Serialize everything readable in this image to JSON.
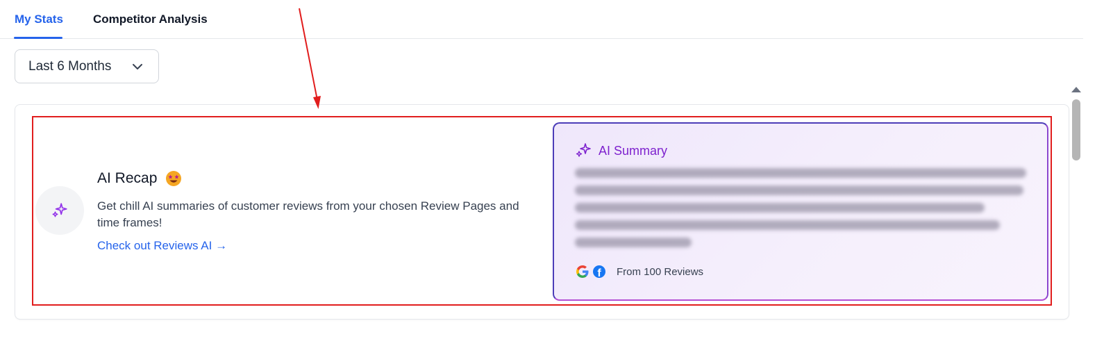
{
  "tabs": [
    {
      "label": "My Stats",
      "active": true
    },
    {
      "label": "Competitor Analysis",
      "active": false
    }
  ],
  "range_select": {
    "value": "Last 6 Months",
    "icon": "chevron-down-icon"
  },
  "recap": {
    "title": "AI Recap",
    "emoji_icon": "star-struck-emoji-icon",
    "description": "Get chill AI summaries of customer reviews from your chosen Review Pages and time frames!",
    "link_label": "Check out Reviews AI →",
    "icon": "sparkles-icon"
  },
  "summary": {
    "title": "AI Summary",
    "icon": "sparkles-icon",
    "source_label": "From 100 Reviews",
    "source_icons": [
      "google-icon",
      "facebook-icon"
    ]
  },
  "colors": {
    "accent": "#2563eb",
    "summary_accent": "#7e22ce",
    "highlight": "#e11d1d"
  }
}
